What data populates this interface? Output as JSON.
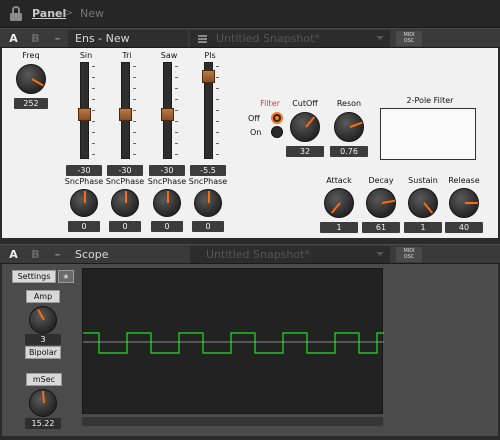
{
  "breadcrumb": {
    "panel_label": "Panel",
    "separator": ">",
    "current": "New"
  },
  "ens": {
    "header": {
      "a_label": "A",
      "b_label": "B",
      "minus_label": "–",
      "name": "Ens - New",
      "snapshot": "Untitled Snapshot*",
      "midi_top": "MIDI",
      "midi_bottom": "OSC"
    },
    "freq": {
      "label": "Freq",
      "value": "252"
    },
    "sliders": [
      {
        "label": "Sin",
        "value": "-30",
        "phase_label": "SncPhase",
        "phase_value": "0",
        "level": 0.45
      },
      {
        "label": "Tri",
        "value": "-30",
        "phase_label": "SncPhase",
        "phase_value": "0",
        "level": 0.45
      },
      {
        "label": "Saw",
        "value": "-30",
        "phase_label": "SncPhase",
        "phase_value": "0",
        "level": 0.45
      },
      {
        "label": "Pls",
        "value": "-5.5",
        "phase_label": "SncPhase",
        "phase_value": "0",
        "level": 0.9
      }
    ],
    "filter": {
      "label": "Filter",
      "off_label": "Off",
      "on_label": "On",
      "selected": "Off",
      "accent_color": "#e03a2a"
    },
    "cutoff": {
      "label": "CutOff",
      "value": "32"
    },
    "reson": {
      "label": "Reson",
      "value": "0.76"
    },
    "pole_filter": {
      "title": "2-Pole Filter"
    },
    "envelope": [
      {
        "label": "Attack",
        "value": "1"
      },
      {
        "label": "Decay",
        "value": "61"
      },
      {
        "label": "Sustain",
        "value": "1"
      },
      {
        "label": "Release",
        "value": "40"
      }
    ]
  },
  "scope": {
    "header": {
      "a_label": "A",
      "b_label": "B",
      "minus_label": "–",
      "name": "Scope",
      "snapshot": "Untitled Snapshot*",
      "midi_top": "MIDI",
      "midi_bottom": "OSC"
    },
    "settings_label": "Settings",
    "star_label": "★",
    "amp": {
      "label": "Amp",
      "value": "3",
      "mode": "Bipolar"
    },
    "msec": {
      "label": "mSec",
      "value": "15.22"
    },
    "trace_color": "#22e022"
  }
}
